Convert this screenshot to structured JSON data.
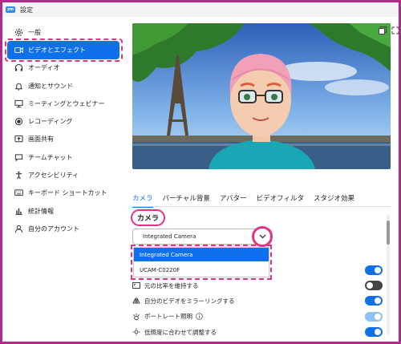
{
  "window": {
    "title": "設定",
    "app_icon": "zoom"
  },
  "sidebar": {
    "items": [
      {
        "label": "一般",
        "icon": "gear-icon",
        "active": false
      },
      {
        "label": "ビデオとエフェクト",
        "icon": "video-camera-icon",
        "active": true
      },
      {
        "label": "オーディオ",
        "icon": "headphones-icon",
        "active": false
      },
      {
        "label": "通知とサウンド",
        "icon": "bell-icon",
        "active": false
      },
      {
        "label": "ミーティングとウェビナー",
        "icon": "presentation-icon",
        "active": false
      },
      {
        "label": "レコーディング",
        "icon": "record-icon",
        "active": false
      },
      {
        "label": "画面共有",
        "icon": "screen-share-icon",
        "active": false
      },
      {
        "label": "チームチャット",
        "icon": "chat-bubble-icon",
        "active": false
      },
      {
        "label": "アクセシビリティ",
        "icon": "accessibility-icon",
        "active": false
      },
      {
        "label": "キーボード ショートカット",
        "icon": "keyboard-icon",
        "active": false
      },
      {
        "label": "統計情報",
        "icon": "bar-chart-icon",
        "active": false
      },
      {
        "label": "自分のアカウント",
        "icon": "user-icon",
        "active": false
      }
    ]
  },
  "tabs": [
    {
      "label": "カメラ",
      "active": true
    },
    {
      "label": "バーチャル背景",
      "active": false
    },
    {
      "label": "アバター",
      "active": false
    },
    {
      "label": "ビデオフィルタ",
      "active": false
    },
    {
      "label": "スタジオ効果",
      "active": false
    }
  ],
  "camera": {
    "heading": "カメラ",
    "selected": "Integrated Camera",
    "options": [
      "Integrated Camera",
      "UCAM-C0220F"
    ]
  },
  "settings": [
    {
      "label": "",
      "toggle": "on",
      "icon": ""
    },
    {
      "label": "元の比率を維持する",
      "toggle": "off",
      "icon": "aspect-ratio-icon"
    },
    {
      "label": "自分のビデオをミラーリングする",
      "toggle": "on",
      "icon": "mirror-icon"
    },
    {
      "label": "ポートレート照明",
      "toggle": "light",
      "icon": "portrait-light-icon",
      "info": true
    },
    {
      "label": "低照度に合わせて調整する",
      "toggle": "on",
      "icon": "low-light-icon"
    }
  ],
  "colors": {
    "accent": "#0e71eb",
    "highlight": "#e0348a",
    "border": "#b12a8a"
  }
}
